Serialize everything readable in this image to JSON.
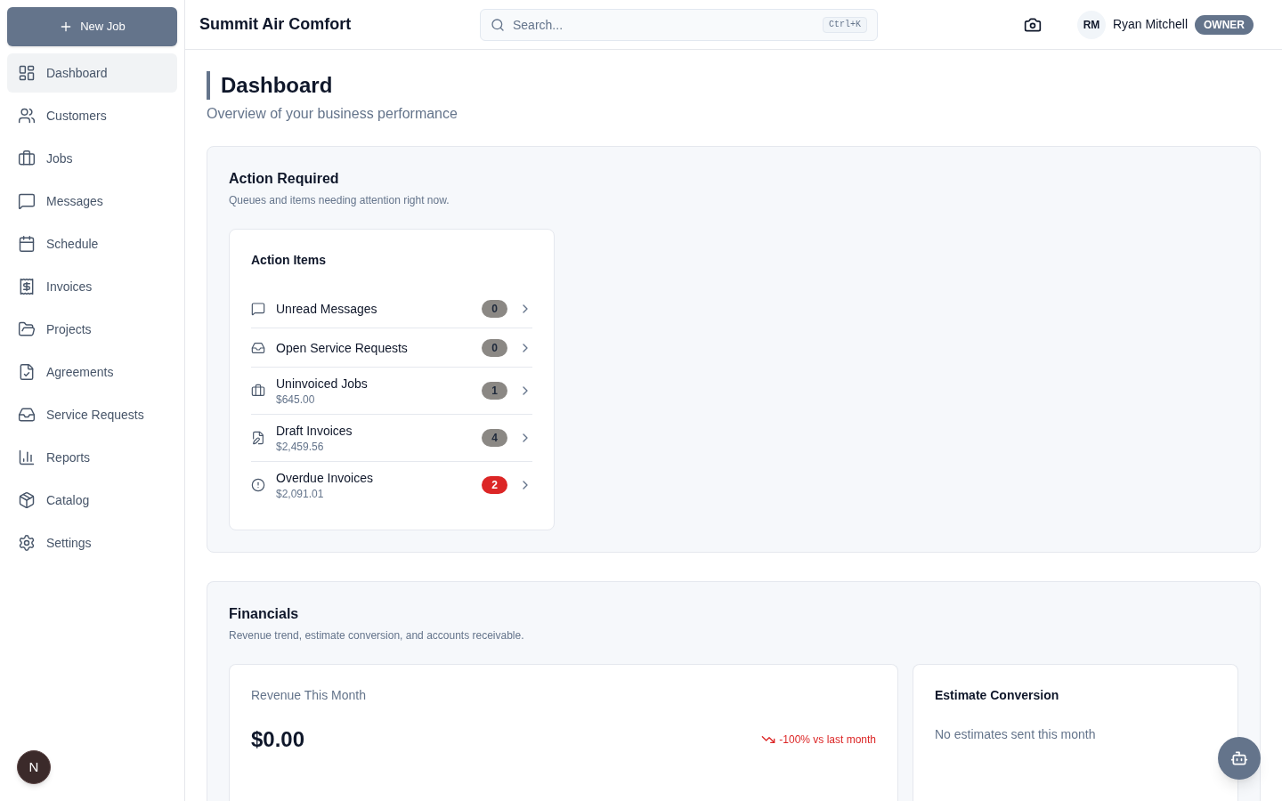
{
  "sidebar": {
    "new_job_button": {
      "label": "New Job"
    },
    "items": [
      {
        "label": "Dashboard",
        "selected": true
      },
      {
        "label": "Customers",
        "selected": false
      },
      {
        "label": "Jobs",
        "selected": false
      },
      {
        "label": "Messages",
        "selected": false
      },
      {
        "label": "Schedule",
        "selected": false
      },
      {
        "label": "Invoices",
        "selected": false
      },
      {
        "label": "Projects",
        "selected": false
      },
      {
        "label": "Agreements",
        "selected": false
      },
      {
        "label": "Service Requests",
        "selected": false
      },
      {
        "label": "Reports",
        "selected": false
      },
      {
        "label": "Catalog",
        "selected": false
      },
      {
        "label": "Settings",
        "selected": false
      }
    ]
  },
  "dev_indicator": {
    "label": "N"
  },
  "header": {
    "title": "Summit Air Comfort",
    "search": {
      "placeholder": "Search...",
      "shortcut": "Ctrl+K"
    },
    "user": {
      "initials": "RM",
      "name": "Ryan Mitchell",
      "role": "OWNER"
    }
  },
  "page": {
    "title": "Dashboard",
    "subtitle": "Overview of your business performance"
  },
  "action_required": {
    "title": "Action Required",
    "description": "Queues and items needing attention right now.",
    "card": {
      "title": "Action Items",
      "items": [
        {
          "label": "Unread Messages",
          "count": "0",
          "color": "#8b8884"
        },
        {
          "label": "Open Service Requests",
          "count": "0",
          "color": "#8b8884"
        },
        {
          "label": "Uninvoiced Jobs",
          "amount": "$645.00",
          "count": "1",
          "color": "#8b8884"
        },
        {
          "label": "Draft Invoices",
          "amount": "$2,459.56",
          "count": "4",
          "color": "#8b8884"
        },
        {
          "label": "Overdue Invoices",
          "amount": "$2,091.01",
          "count": "2",
          "color": "#dc2626"
        }
      ]
    }
  },
  "financials": {
    "title": "Financials",
    "description": "Revenue trend, estimate conversion, and accounts receivable.",
    "revenue_card": {
      "title": "Revenue This Month",
      "value": "$0.00",
      "trend": {
        "negative": true,
        "text": "-100% vs last month"
      }
    },
    "estimate_card": {
      "title": "Estimate Conversion",
      "message": "No estimates sent this month"
    }
  }
}
